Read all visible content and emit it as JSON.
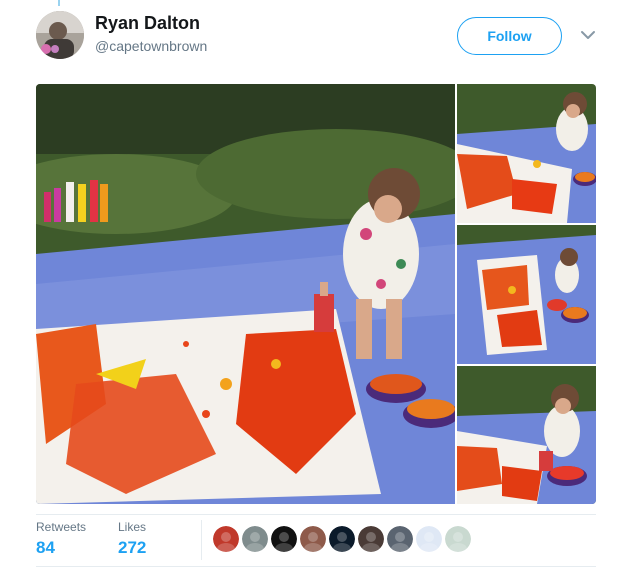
{
  "user": {
    "display_name": "Ryan Dalton",
    "handle": "@capetownbrown",
    "avatar_icon": "profile-photo"
  },
  "actions": {
    "follow_label": "Follow",
    "more_icon": "chevron-down-icon"
  },
  "media": {
    "photos": [
      "photo-child-painting-large",
      "photo-child-sitting-canvas",
      "photo-child-canvas-wide",
      "photo-child-painting-close"
    ]
  },
  "stats": {
    "retweets_label": "Retweets",
    "retweets_count": "84",
    "likes_label": "Likes",
    "likes_count": "272"
  },
  "likers": {
    "avatar_colors": [
      "#c0392b",
      "#7f8c8d",
      "#111111",
      "#8e5a4a",
      "#0b1a2a",
      "#4a3b36",
      "#5a6470",
      "#dfe8f5",
      "#c9d9d0"
    ]
  },
  "colors": {
    "accent": "#1da1f2",
    "secondary_text": "#657786",
    "primary_text": "#14171a"
  }
}
